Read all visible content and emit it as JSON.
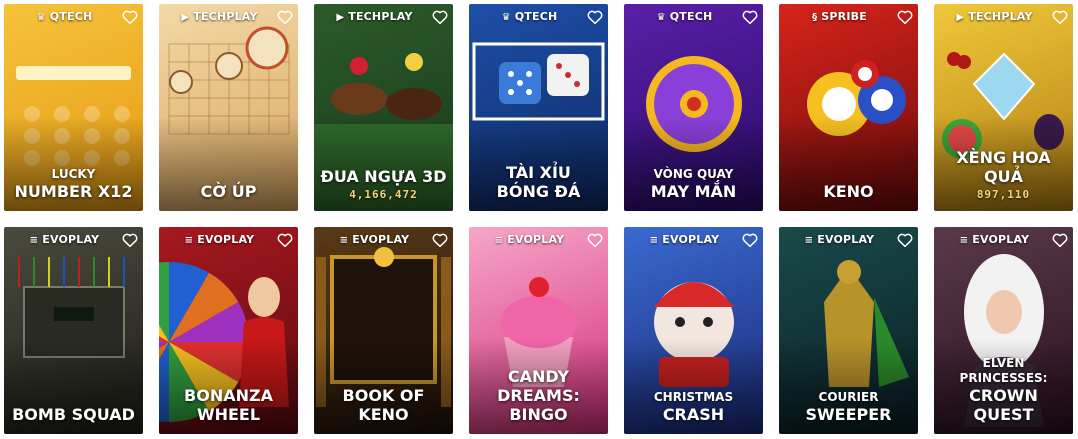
{
  "cards": [
    {
      "provider": "QTECH",
      "provider_icon": "qtech-crown-icon",
      "title_top": "LUCKY",
      "title": "NUMBER X12",
      "players": "",
      "art_label": "LUCKY NUMBER X12",
      "bg": [
        "#f6c23a",
        "#e59a14"
      ]
    },
    {
      "provider": "TECHPLAY",
      "provider_icon": "techplay-play-icon",
      "title_top": "",
      "title": "CỜ ÚP",
      "players": "",
      "art_label": "",
      "bg": [
        "#f3d9a6",
        "#d9a660"
      ]
    },
    {
      "provider": "TECHPLAY",
      "provider_icon": "techplay-play-icon",
      "title_top": "",
      "title": "ĐUA NGỰA 3D",
      "players": "4,166,472",
      "art_label": "",
      "bg": [
        "#2d5a2a",
        "#173a1b"
      ]
    },
    {
      "provider": "QTECH",
      "provider_icon": "qtech-crown-icon",
      "title_top": "",
      "title": "TÀI XỈU\nBÓNG ĐÁ",
      "players": "",
      "art_label": "",
      "bg": [
        "#1e4fa8",
        "#0e2a66"
      ]
    },
    {
      "provider": "QTECH",
      "provider_icon": "qtech-crown-icon",
      "title_top": "VÒNG QUAY",
      "title": "MAY MẮN",
      "players": "",
      "art_label": "",
      "bg": [
        "#5a1fa8",
        "#2a0b6a"
      ]
    },
    {
      "provider": "SPRIBE",
      "provider_icon": "spribe-s-icon",
      "title_top": "",
      "title": "KENO",
      "players": "",
      "art_label": "",
      "bg": [
        "#d6241a",
        "#6e0b0b"
      ]
    },
    {
      "provider": "TECHPLAY",
      "provider_icon": "techplay-play-icon",
      "title_top": "",
      "title": "XÈNG HOA QUẢ",
      "players": "897,110",
      "art_label": "",
      "bg": [
        "#f0c83a",
        "#b07e12"
      ]
    },
    {
      "provider": "EVOPLAY",
      "provider_icon": "evoplay-e-icon",
      "title_top": "",
      "title": "BOMB SQUAD",
      "players": "",
      "art_label": "",
      "bg": [
        "#4a4a3e",
        "#1e1e18"
      ]
    },
    {
      "provider": "EVOPLAY",
      "provider_icon": "evoplay-e-icon",
      "title_top": "",
      "title": "BONANZA WHEEL",
      "players": "",
      "art_label": "",
      "bg": [
        "#a81820",
        "#5a0a10"
      ]
    },
    {
      "provider": "EVOPLAY",
      "provider_icon": "evoplay-e-icon",
      "title_top": "",
      "title": "BOOK OF KENO",
      "players": "",
      "art_label": "",
      "bg": [
        "#5a3a18",
        "#1e120a"
      ]
    },
    {
      "provider": "EVOPLAY",
      "provider_icon": "evoplay-e-icon",
      "title_top": "",
      "title": "CANDY DREAMS:\nBINGO",
      "players": "",
      "art_label": "",
      "bg": [
        "#f6a6c8",
        "#d4307a"
      ]
    },
    {
      "provider": "EVOPLAY",
      "provider_icon": "evoplay-e-icon",
      "title_top": "CHRISTMAS",
      "title": "CRASH",
      "players": "",
      "art_label": "",
      "bg": [
        "#3a6ad0",
        "#1a2a7a"
      ]
    },
    {
      "provider": "EVOPLAY",
      "provider_icon": "evoplay-e-icon",
      "title_top": "COURIER",
      "title": "SWEEPER",
      "players": "",
      "art_label": "",
      "bg": [
        "#1a4a4a",
        "#0a1e24"
      ]
    },
    {
      "provider": "EVOPLAY",
      "provider_icon": "evoplay-e-icon",
      "title_top": "ELVEN PRINCESSES:",
      "title": "CROWN QUEST",
      "players": "",
      "art_label": "",
      "bg": [
        "#5a3a4a",
        "#2a1020"
      ]
    }
  ],
  "ui": {
    "favorite_icon": "heart-outline-icon",
    "text_color": "#ffffff",
    "players_color": "#f4d27a"
  }
}
